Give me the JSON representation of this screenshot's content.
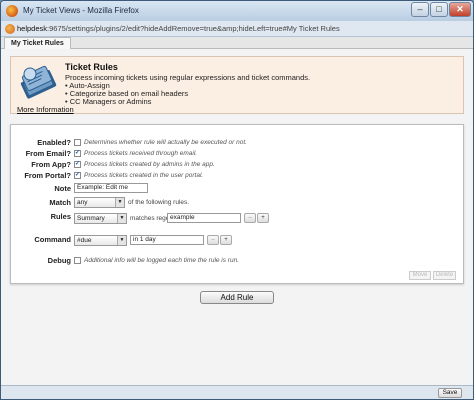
{
  "window": {
    "title": "My Ticket Views - Mozilla Firefox",
    "minimize_glyph": "–",
    "maximize_glyph": "□",
    "close_glyph": "✕"
  },
  "address_bar": {
    "host": "helpdesk",
    "path": ":9675/settings/plugins/2/edit?hideAddRemove=true&amp;hideLeft=true#My Ticket Rules"
  },
  "tab": {
    "label": "My Ticket Rules"
  },
  "info": {
    "title": "Ticket Rules",
    "description": "Process incoming tickets using regular expressions and ticket commands.",
    "features": [
      "Auto-Assign",
      "Categorize based on email headers",
      "CC Managers or Admins"
    ],
    "more_link": "More Information"
  },
  "form": {
    "enabled": {
      "label": "Enabled?",
      "checked": false,
      "hint": "Determines whether rule will actually be executed or not."
    },
    "from_email": {
      "label": "From Email?",
      "checked": true,
      "hint": "Process tickets received through email."
    },
    "from_app": {
      "label": "From App?",
      "checked": true,
      "hint": "Process tickets created by admins in the app."
    },
    "from_portal": {
      "label": "From Portal?",
      "checked": true,
      "hint": "Process tickets created in the user portal."
    },
    "note": {
      "label": "Note",
      "value": "Example: Edit me"
    },
    "match": {
      "label": "Match",
      "selected": "any",
      "suffix": "of the following rules."
    },
    "rules": {
      "label": "Rules",
      "field": "Summary",
      "operator": "matches regex",
      "value": "example",
      "remove": "–",
      "add": "+"
    },
    "command": {
      "label": "Command",
      "name": "#due",
      "value": "in 1 day",
      "remove": "–",
      "add": "+"
    },
    "debug": {
      "label": "Debug",
      "checked": false,
      "hint": "Additional info will be logged each time the rule is run."
    },
    "move_button": "Move",
    "delete_button": "Delete"
  },
  "add_rule_button": "Add Rule",
  "footer": {
    "save_button": "Save"
  },
  "colors": {
    "info_background": "#fbeee3",
    "titlebar": "#c8d9ea",
    "checkbox_check": "#1b4fb0"
  }
}
